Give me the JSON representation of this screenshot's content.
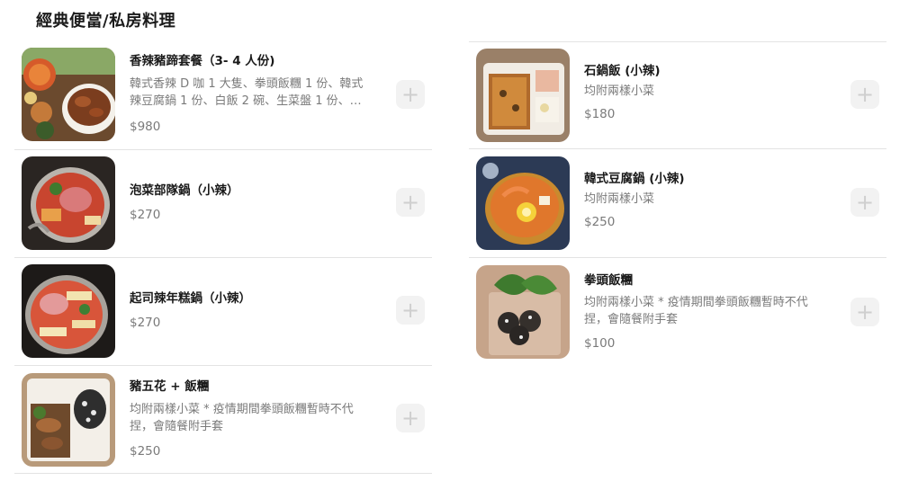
{
  "section": {
    "title": "經典便當/私房料理"
  },
  "left_items": [
    {
      "name": "香辣豬蹄套餐（3- 4 人份)",
      "description": "韓式香辣 D 咖 1 大隻、拳頭飯糰 1 份、韓式辣豆腐鍋 1 份、白飯 2 碗、生菜盤 1 份、小...",
      "price": "$980",
      "add_label": "+"
    },
    {
      "name": "泡菜部隊鍋（小辣）",
      "description": "",
      "price": "$270",
      "add_label": "+"
    },
    {
      "name": "起司辣年糕鍋（小辣）",
      "description": "",
      "price": "$270",
      "add_label": "+"
    },
    {
      "name": "豬五花 + 飯糰",
      "description": "均附兩樣小菜 * 疫情期間拳頭飯糰暫時不代捏，會隨餐附手套",
      "price": "$250",
      "add_label": "+"
    }
  ],
  "right_items": [
    {
      "name": "石鍋飯 (小辣)",
      "description": "均附兩樣小菜",
      "price": "$180",
      "add_label": "+"
    },
    {
      "name": "韓式豆腐鍋 (小辣)",
      "description": "均附兩樣小菜",
      "price": "$250",
      "add_label": "+"
    },
    {
      "name": "拳頭飯糰",
      "description": "均附兩樣小菜 * 疫情期間拳頭飯糰暫時不代捏，會隨餐附手套",
      "price": "$100",
      "add_label": "+"
    }
  ]
}
